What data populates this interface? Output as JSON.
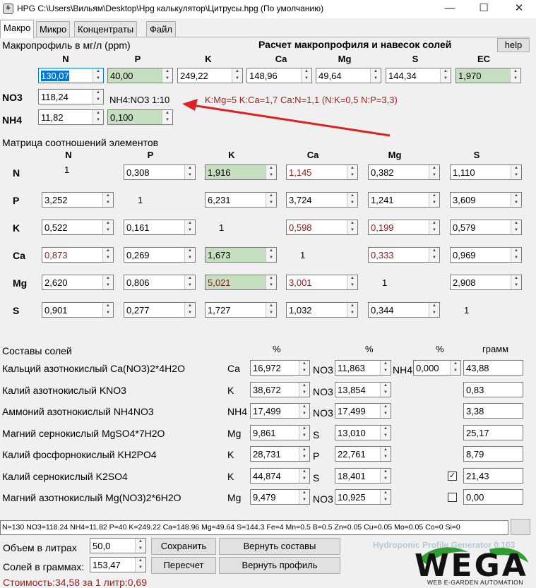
{
  "window": {
    "title": "HPG C:\\Users\\Вильям\\Desktop\\Hpg калькулятор\\Цитрусы.hpg (По умолчанию)",
    "app_icon": "leaf-app-icon",
    "minimize": "—",
    "maximize": "☐",
    "close": "✕"
  },
  "tabs": [
    "Макро",
    "Микро",
    "Концентраты",
    "Файл"
  ],
  "macro": {
    "section_label": "Макропрофиль в мг/л (ppm)",
    "calc_title": "Расчет макропрофиля и навесок солей",
    "help_label": "help",
    "columns": [
      "N",
      "P",
      "K",
      "Ca",
      "Mg",
      "S",
      "EC"
    ],
    "values": [
      "130,07",
      "40,00",
      "249,22",
      "148,96",
      "49,64",
      "144,34",
      "1,970"
    ],
    "no3_label": "NO3",
    "no3_value": "118,24",
    "nh4_label": "NH4",
    "nh4_value": "11,82",
    "ratio_label": "NH4:NO3 1:10",
    "ratio_value": "0,100",
    "ratios_text": "K:Mg=5 K:Ca=1,7 Ca:N=1,1 (N:K=0,5 N:P=3,3)"
  },
  "matrix": {
    "label": "Матрица соотношений элементов",
    "cols": [
      "N",
      "P",
      "K",
      "Ca",
      "Mg",
      "S"
    ],
    "rows": [
      {
        "name": "N",
        "cells": [
          "1",
          "0,308",
          "1,916",
          "1,145",
          "0,382",
          "1,110"
        ]
      },
      {
        "name": "P",
        "cells": [
          "3,252",
          "1",
          "6,231",
          "3,724",
          "1,241",
          "3,609"
        ]
      },
      {
        "name": "K",
        "cells": [
          "0,522",
          "0,161",
          "1",
          "0,598",
          "0,199",
          "0,579"
        ]
      },
      {
        "name": "Ca",
        "cells": [
          "0,873",
          "0,269",
          "1,673",
          "1",
          "0,333",
          "0,969"
        ]
      },
      {
        "name": "Mg",
        "cells": [
          "2,620",
          "0,806",
          "5,021",
          "3,001",
          "1",
          "2,908"
        ]
      },
      {
        "name": "S",
        "cells": [
          "0,901",
          "0,277",
          "1,727",
          "1,032",
          "0,344",
          "1"
        ]
      }
    ]
  },
  "salts": {
    "label": "Составы солей",
    "pct_header": "%",
    "gram_header": "грамм",
    "items": [
      {
        "name": "Кальций азотнокислый Ca(NO3)2*4H2O",
        "el1": "Ca",
        "v1": "16,972",
        "el2": "NO3",
        "v2": "11,863",
        "el3": "NH4",
        "v3": "0,000",
        "grams": "43,88"
      },
      {
        "name": "Калий азотнокислый KNO3",
        "el1": "K",
        "v1": "38,672",
        "el2": "NO3",
        "v2": "13,854",
        "grams": "0,83"
      },
      {
        "name": "Аммоний азотнокислый NH4NO3",
        "el1": "NH4",
        "v1": "17,499",
        "el2": "NO3",
        "v2": "17,499",
        "grams": "3,38"
      },
      {
        "name": "Магний сернокислый MgSO4*7H2O",
        "el1": "Mg",
        "v1": "9,861",
        "el2": "S",
        "v2": "13,010",
        "grams": "25,17"
      },
      {
        "name": "Калий фосфорнокислый KH2PO4",
        "el1": "K",
        "v1": "28,731",
        "el2": "P",
        "v2": "22,761",
        "grams": "8,79"
      },
      {
        "name": "Калий сернокислый K2SO4",
        "el1": "K",
        "v1": "44,874",
        "el2": "S",
        "v2": "18,401",
        "check": "✓",
        "grams": "21,43"
      },
      {
        "name": "Магний азотнокислый Mg(NO3)2*6H2O",
        "el1": "Mg",
        "v1": "9,479",
        "el2": "NO3",
        "v2": "10,925",
        "check": "",
        "grams": "0,00"
      }
    ]
  },
  "summary": "N=130 NO3=118.24 NH4=11.82 P=40 K=249.22 Ca=148.96 Mg=49.64 S=144.3 Fe=4 Mn=0.5 B=0.5 Zn=0.05 Cu=0.05 Mo=0.05 Co=0 Si=0",
  "footer": {
    "volume_label": "Объем в литрах",
    "volume_value": "50,0",
    "salts_label": "Солей в граммах:",
    "salts_value": "153,47",
    "save": "Сохранить",
    "restore_compositions": "Вернуть составы",
    "recalc": "Пересчет",
    "restore_profile": "Вернуть профиль",
    "cost": "Стоимость:34,58 за 1 литр:0,69",
    "brand": "Hydroponic Profile Generator 0.103",
    "logo_text": "WEGA",
    "logo_sub": "WEB E-GARDEN AUTOMATION"
  },
  "colors": {
    "green_field": "#c5dfc0",
    "red_text": "#8b1a1a",
    "arrow": "#e02020",
    "ratio_text": "#a02020"
  }
}
